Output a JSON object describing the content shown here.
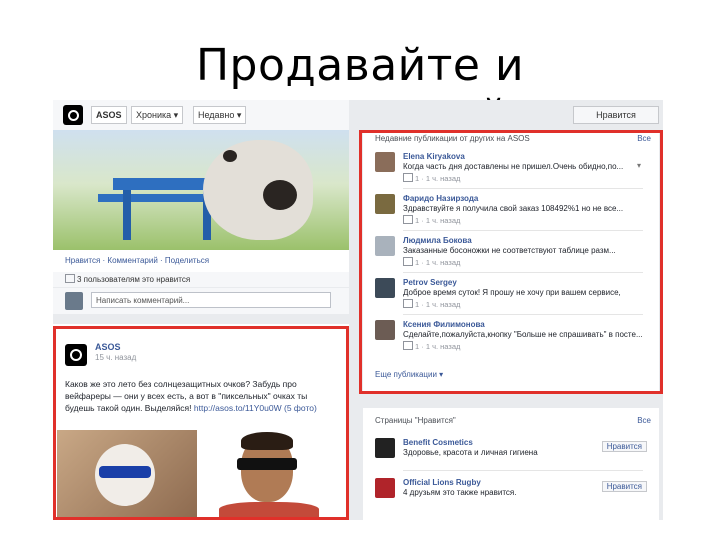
{
  "slide": {
    "title": "Продавайте и коммуницируйте"
  },
  "left": {
    "topbar": {
      "brand": "ASOS",
      "menu1": "Хроника ▾",
      "menu2": "Недавно ▾"
    },
    "actions": "Нравится · Комментарий · Поделиться",
    "likes": "3 пользователям это нравится",
    "comment_placeholder": "Написать комментарий...",
    "post": {
      "name": "ASOS",
      "time": "15 ч. назад",
      "text1": "Каков же это лето без солнцезащитных очков? Забудь про",
      "text2": "вейфареры — они у всех есть, а вот в \"пиксельных\" очках ты",
      "text3": "будешь такой один. Выделяйся!",
      "link": "http://asos.to/11Y0u0W",
      "photo_count": "(5 фото)"
    }
  },
  "right": {
    "like_button": "Нравится",
    "header": "Недавние публикации от других на ASOS",
    "header_all": "Все",
    "items": [
      {
        "name": "Elena Kiryakova",
        "text": "Когда часть дня доставлены не пришел.Очень обидно,по...",
        "meta": "1 · 1 ч. назад",
        "color": "#8a6d5a"
      },
      {
        "name": "Фаридо Назирзода",
        "text": "Здравствуйте я получила свой заказ 108492%1 но не все...",
        "meta": "1 · 1 ч. назад",
        "color": "#7a6a40"
      },
      {
        "name": "Людмила Бокова",
        "text": "Заказанные босоножки не соответствуют таблице разм...",
        "meta": "1 · 1 ч. назад",
        "color": "#a9b2bc"
      },
      {
        "name": "Petrov Sergey",
        "text": "Доброе время суток! Я прошу не хочу при вашем сервисе,",
        "meta": "1 · 1 ч. назад",
        "color": "#3c4a58"
      },
      {
        "name": "Ксения Филимонова",
        "text": "Сделайте,пожалуйста,кнопку \"Больше не спрашивать\" в посте...",
        "meta": "1 · 1 ч. назад",
        "color": "#6c5c54"
      }
    ],
    "see_all": "Еще публикации ▾",
    "pages_header": "Страницы \"Нравится\"",
    "pages_all": "Все",
    "pages": [
      {
        "name": "Benefit Cosmetics",
        "text": "Здоровье, красота и личная гигиена",
        "button": "Нравится",
        "color": "#222222"
      },
      {
        "name": "Official Lions Rugby",
        "text": "4 друзьям это также нравится.",
        "button": "Нравится",
        "color": "#b0242a"
      }
    ]
  },
  "colors": {
    "accent": "#3b5998",
    "highlight": "#e0302a"
  }
}
